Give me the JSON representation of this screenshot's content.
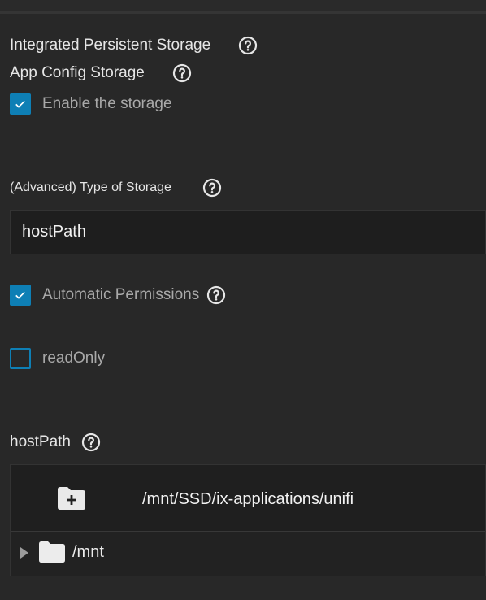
{
  "storage_section": {
    "title": "Integrated Persistent Storage",
    "app_config": {
      "title": "App Config Storage",
      "enable_label": "Enable the storage",
      "enable_checked": true
    }
  },
  "type_of_storage": {
    "label": "(Advanced) Type of Storage",
    "selected": "hostPath"
  },
  "automatic_permissions": {
    "label": "Automatic Permissions",
    "checked": true
  },
  "read_only": {
    "label": "readOnly",
    "checked": false
  },
  "host_path": {
    "label": "hostPath",
    "current_path": "/mnt/SSD/ix-applications/unifi",
    "tree": [
      {
        "label": "/mnt",
        "icon": "folder-icon",
        "expanded": false
      }
    ]
  },
  "colors": {
    "accent": "#0e7fb5",
    "background": "#282828",
    "field_background": "#1e1e1e"
  }
}
